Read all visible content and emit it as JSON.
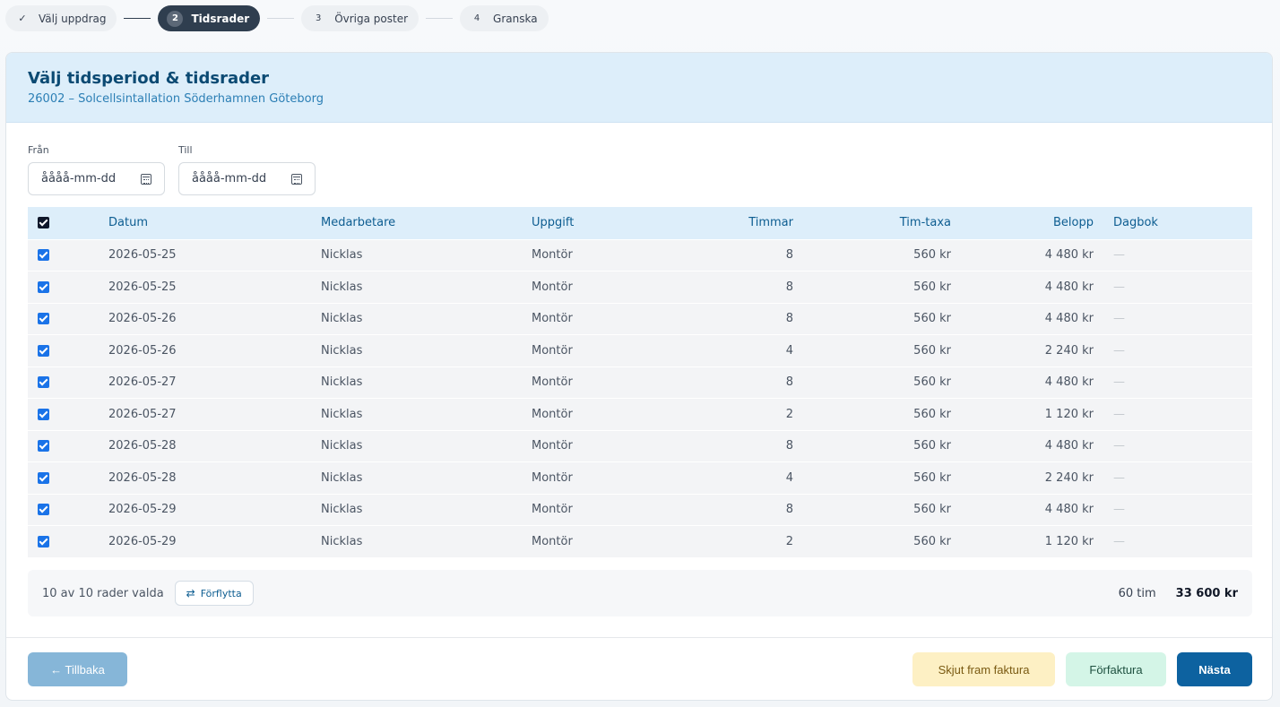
{
  "stepper": [
    {
      "num": "✓",
      "label": "Välj uppdrag",
      "state": "done"
    },
    {
      "num": "2",
      "label": "Tidsrader",
      "state": "active"
    },
    {
      "num": "3",
      "label": "Övriga poster",
      "state": "todo"
    },
    {
      "num": "4",
      "label": "Granska",
      "state": "todo"
    }
  ],
  "header": {
    "title": "Välj tidsperiod & tidsrader",
    "subtitle": "26002 – Solcellsintallation Söderhamnen Göteborg"
  },
  "filters": {
    "from_label": "Från",
    "from_value": "åååå-mm-dd",
    "to_label": "Till",
    "to_value": "åååå-mm-dd"
  },
  "table": {
    "columns": [
      "Datum",
      "Medarbetare",
      "Uppgift",
      "Timmar",
      "Tim-taxa",
      "Belopp",
      "Dagbok"
    ],
    "rows": [
      {
        "date": "2026-05-25",
        "employee": "Nicklas",
        "task": "Montör",
        "hours": "8",
        "rate": "560 kr",
        "amount": "4 480 kr",
        "log": "—"
      },
      {
        "date": "2026-05-25",
        "employee": "Nicklas",
        "task": "Montör",
        "hours": "8",
        "rate": "560 kr",
        "amount": "4 480 kr",
        "log": "—"
      },
      {
        "date": "2026-05-26",
        "employee": "Nicklas",
        "task": "Montör",
        "hours": "8",
        "rate": "560 kr",
        "amount": "4 480 kr",
        "log": "—"
      },
      {
        "date": "2026-05-26",
        "employee": "Nicklas",
        "task": "Montör",
        "hours": "4",
        "rate": "560 kr",
        "amount": "2 240 kr",
        "log": "—"
      },
      {
        "date": "2026-05-27",
        "employee": "Nicklas",
        "task": "Montör",
        "hours": "8",
        "rate": "560 kr",
        "amount": "4 480 kr",
        "log": "—"
      },
      {
        "date": "2026-05-27",
        "employee": "Nicklas",
        "task": "Montör",
        "hours": "2",
        "rate": "560 kr",
        "amount": "1 120 kr",
        "log": "—"
      },
      {
        "date": "2026-05-28",
        "employee": "Nicklas",
        "task": "Montör",
        "hours": "8",
        "rate": "560 kr",
        "amount": "4 480 kr",
        "log": "—"
      },
      {
        "date": "2026-05-28",
        "employee": "Nicklas",
        "task": "Montör",
        "hours": "4",
        "rate": "560 kr",
        "amount": "2 240 kr",
        "log": "—"
      },
      {
        "date": "2026-05-29",
        "employee": "Nicklas",
        "task": "Montör",
        "hours": "8",
        "rate": "560 kr",
        "amount": "4 480 kr",
        "log": "—"
      },
      {
        "date": "2026-05-29",
        "employee": "Nicklas",
        "task": "Montör",
        "hours": "2",
        "rate": "560 kr",
        "amount": "1 120 kr",
        "log": "—"
      }
    ]
  },
  "summary": {
    "selected_text": "10 av 10 rader valda",
    "move_label": "Förflytta",
    "total_hours": "60 tim",
    "total_amount": "33 600 kr"
  },
  "footer": {
    "back_label": "← Tillbaka",
    "postpone_label": "Skjut fram faktura",
    "prefak_label": "Förfaktura",
    "next_label": "Nästa"
  },
  "colors": {
    "accent": "#0d62a0",
    "header_bg": "#ddeefa",
    "checkbox": "#1a73e8"
  },
  "icons": {
    "calendar": "calendar-icon",
    "move": "swap-arrows-icon",
    "checkmark": "check-icon"
  }
}
